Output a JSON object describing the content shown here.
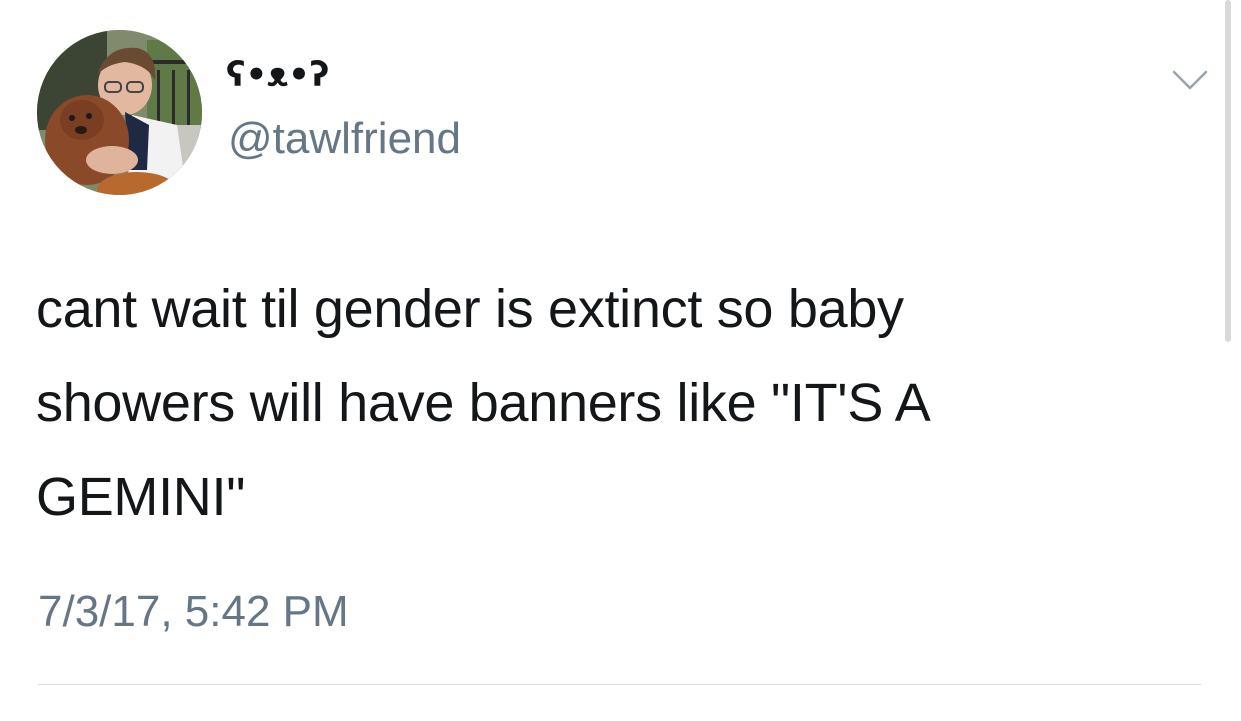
{
  "tweet": {
    "display_name": "ʕ•ᴥ•ʔ",
    "handle": "@tawlfriend",
    "text_lines": [
      "cant wait til gender is extinct so baby",
      "showers will have banners like \"IT'S A",
      "GEMINI\""
    ],
    "timestamp": "7/3/17, 5:42 PM"
  },
  "icons": {
    "menu": "chevron-down-icon",
    "avatar": "profile-photo"
  },
  "colors": {
    "text": "#14171a",
    "secondary_text": "#657786",
    "divider": "#d8dce0",
    "background": "#ffffff"
  }
}
